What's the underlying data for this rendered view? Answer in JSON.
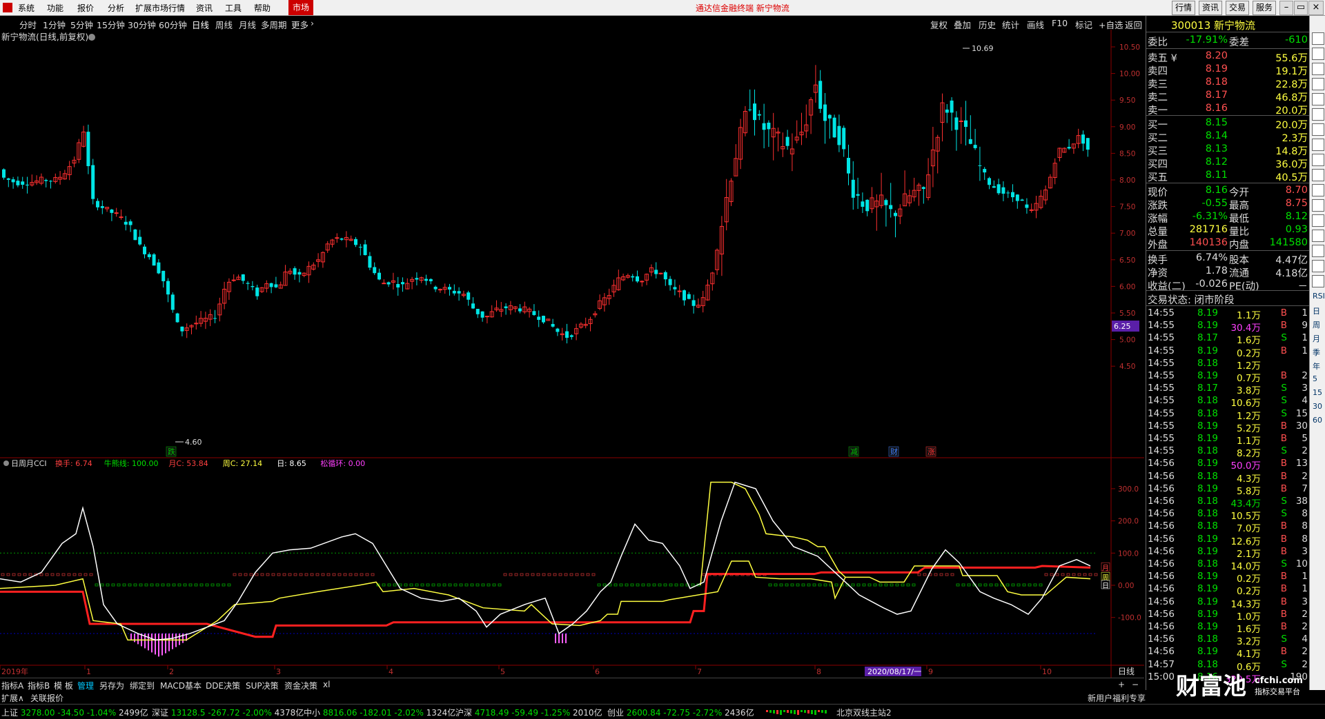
{
  "menubar": {
    "items": [
      "系统",
      "功能",
      "报价",
      "分析",
      "扩展市场行情",
      "资讯",
      "工具",
      "帮助"
    ],
    "market": "市场",
    "app_title": "通达信金融终端  新宁物流",
    "right_buttons": [
      "行情",
      "资讯",
      "交易",
      "服务"
    ]
  },
  "periodbar": {
    "periods": [
      "分时",
      "1分钟",
      "5分钟",
      "15分钟",
      "30分钟",
      "60分钟",
      "日线",
      "周线",
      "月线",
      "多周期",
      "更多"
    ],
    "active": "日线",
    "right": [
      "复权",
      "叠加",
      "历史",
      "统计",
      "画线",
      "F10",
      "标记",
      "+自选",
      "返回"
    ]
  },
  "chart": {
    "title": "新宁物流(日线,前复权)",
    "price_axis": [
      "10.50",
      "10.00",
      "9.50",
      "9.00",
      "8.50",
      "8.00",
      "7.50",
      "7.00",
      "6.50",
      "6.00",
      "5.50",
      "5.00",
      "4.50"
    ],
    "current_price_tag": "6.25",
    "high_label": "10.69",
    "low_label": "4.60",
    "markers": [
      {
        "text": "跌",
        "color": "#00c000"
      },
      {
        "text": "减",
        "color": "#00c000"
      },
      {
        "text": "财",
        "color": "#4080ff"
      },
      {
        "text": "涨",
        "color": "#ff3030"
      }
    ],
    "indicator": {
      "name": "日周月CCI",
      "items": [
        {
          "text": "换手: 6.74",
          "color": "#ff4040"
        },
        {
          "text": "牛熊线: 100.00",
          "color": "#00e000"
        },
        {
          "text": "月C: 53.84",
          "color": "#ff4040"
        },
        {
          "text": "周C: 27.14",
          "color": "#ffff40"
        },
        {
          "text": "日: 8.65",
          "color": "#ffffff"
        },
        {
          "text": "松循环: 0.00",
          "color": "#ff40ff"
        }
      ],
      "axis": [
        "300.0",
        "200.0",
        "100.0",
        "0.00",
        "-100.0"
      ],
      "end_labels": [
        "月",
        "周",
        "日"
      ]
    },
    "date_axis": [
      "2019年",
      "1",
      "2",
      "3",
      "4",
      "5",
      "6",
      "7",
      "8",
      "9",
      "10"
    ],
    "date_highlight": "2020/08/17/一",
    "period_label": "日线"
  },
  "bottom_tabs": [
    "指标A",
    "指标B",
    "模 板",
    "管理",
    "另存为",
    "绑定到",
    "MACD基本",
    "DDE决策",
    "SUP决策",
    "资金决策",
    "xl"
  ],
  "bottom_tabs2": [
    "扩展∧",
    "关联报价"
  ],
  "bottom_right": "新用户福利专享",
  "quote": {
    "code_name": "300013 新宁物流",
    "weibi": {
      "label": "委比",
      "value": "-17.91%",
      "label2": "委差",
      "value2": "-610"
    },
    "asks": [
      {
        "label": "卖五",
        "mark": "¥",
        "price": "8.20",
        "vol": "55.6万"
      },
      {
        "label": "卖四",
        "mark": "",
        "price": "8.19",
        "vol": "19.1万"
      },
      {
        "label": "卖三",
        "mark": "",
        "price": "8.18",
        "vol": "22.8万"
      },
      {
        "label": "卖二",
        "mark": "",
        "price": "8.17",
        "vol": "46.8万"
      },
      {
        "label": "卖一",
        "mark": "",
        "price": "8.16",
        "vol": "20.0万"
      }
    ],
    "bids": [
      {
        "label": "买一",
        "price": "8.15",
        "vol": "20.0万"
      },
      {
        "label": "买二",
        "price": "8.14",
        "vol": "2.3万"
      },
      {
        "label": "买三",
        "price": "8.13",
        "vol": "14.8万"
      },
      {
        "label": "买四",
        "price": "8.12",
        "vol": "36.0万"
      },
      {
        "label": "买五",
        "price": "8.11",
        "vol": "40.5万"
      }
    ],
    "stats": [
      {
        "l1": "现价",
        "v1": "8.16",
        "c1": "#00e000",
        "l2": "今开",
        "v2": "8.70",
        "c2": "#ff5050"
      },
      {
        "l1": "涨跌",
        "v1": "-0.55",
        "c1": "#00e000",
        "l2": "最高",
        "v2": "8.75",
        "c2": "#ff5050"
      },
      {
        "l1": "涨幅",
        "v1": "-6.31%",
        "c1": "#00e000",
        "l2": "最低",
        "v2": "8.12",
        "c2": "#00e000"
      },
      {
        "l1": "总量",
        "v1": "281716",
        "c1": "#ffff40",
        "l2": "量比",
        "v2": "0.93",
        "c2": "#00e000"
      },
      {
        "l1": "外盘",
        "v1": "140136",
        "c1": "#ff5050",
        "l2": "内盘",
        "v2": "141580",
        "c2": "#00e000"
      }
    ],
    "stats2": [
      {
        "l1": "换手",
        "v1": "6.74%",
        "l2": "股本",
        "v2": "4.47亿"
      },
      {
        "l1": "净资",
        "v1": "1.78",
        "l2": "流通",
        "v2": "4.18亿"
      },
      {
        "l1": "收益(二)",
        "v1": "-0.026",
        "l2": "PE(动)",
        "v2": "－"
      }
    ],
    "trade_status": "交易状态: 闭市阶段",
    "ticks": [
      [
        "14:55",
        "8.19",
        "1.1万",
        "B",
        "1"
      ],
      [
        "14:55",
        "8.19",
        "30.4万",
        "B",
        "9"
      ],
      [
        "14:55",
        "8.17",
        "1.6万",
        "S",
        "1"
      ],
      [
        "14:55",
        "8.19",
        "0.2万",
        "B",
        "1"
      ],
      [
        "14:55",
        "8.18",
        "1.2万",
        "",
        ""
      ],
      [
        "14:55",
        "8.19",
        "0.7万",
        "B",
        "2"
      ],
      [
        "14:55",
        "8.17",
        "3.8万",
        "S",
        "3"
      ],
      [
        "14:55",
        "8.18",
        "10.6万",
        "S",
        "4"
      ],
      [
        "14:55",
        "8.18",
        "1.2万",
        "S",
        "15"
      ],
      [
        "14:55",
        "8.19",
        "5.2万",
        "B",
        "30"
      ],
      [
        "14:55",
        "8.19",
        "1.1万",
        "B",
        "5"
      ],
      [
        "14:55",
        "8.18",
        "8.2万",
        "S",
        "2"
      ],
      [
        "14:56",
        "8.19",
        "50.0万",
        "B",
        "13"
      ],
      [
        "14:56",
        "8.18",
        "4.3万",
        "B",
        "2"
      ],
      [
        "14:56",
        "8.19",
        "5.8万",
        "B",
        "7"
      ],
      [
        "14:56",
        "8.18",
        "43.4万",
        "S",
        "38"
      ],
      [
        "14:56",
        "8.18",
        "10.5万",
        "S",
        "8"
      ],
      [
        "14:56",
        "8.18",
        "7.0万",
        "B",
        "8"
      ],
      [
        "14:56",
        "8.19",
        "12.6万",
        "B",
        "8"
      ],
      [
        "14:56",
        "8.19",
        "2.1万",
        "B",
        "3"
      ],
      [
        "14:56",
        "8.18",
        "14.0万",
        "S",
        "10"
      ],
      [
        "14:56",
        "8.19",
        "0.2万",
        "B",
        "1"
      ],
      [
        "14:56",
        "8.19",
        "0.2万",
        "B",
        "1"
      ],
      [
        "14:56",
        "8.19",
        "14.3万",
        "B",
        "3"
      ],
      [
        "14:56",
        "8.19",
        "1.0万",
        "B",
        "2"
      ],
      [
        "14:56",
        "8.19",
        "1.6万",
        "B",
        "2"
      ],
      [
        "14:56",
        "8.18",
        "3.2万",
        "S",
        "4"
      ],
      [
        "14:56",
        "8.19",
        "4.1万",
        "B",
        "2"
      ],
      [
        "14:57",
        "8.18",
        "0.6万",
        "S",
        "2"
      ],
      [
        "15:00",
        "8.16",
        "329.5万",
        "",
        "190"
      ]
    ]
  },
  "side_tools": [
    "RSI",
    "日",
    "周",
    "月",
    "季",
    "年",
    "5",
    "15",
    "30",
    "60"
  ],
  "statusbar": [
    {
      "name": "上证",
      "price": "3278.00",
      "chg": "-34.50",
      "pct": "-1.04%",
      "amt": "2499亿"
    },
    {
      "name": "深证",
      "price": "13128.5",
      "chg": "-267.72",
      "pct": "-2.00%",
      "amt": "4378亿"
    },
    {
      "name": "中小",
      "price": "8816.06",
      "chg": "-182.01",
      "pct": "-2.02%",
      "amt": "1324亿"
    },
    {
      "name": "沪深",
      "price": "4718.49",
      "chg": "-59.49",
      "pct": "-1.25%",
      "amt": "2010亿"
    },
    {
      "name": "创业",
      "price": "2600.84",
      "chg": "-72.75",
      "pct": "-2.72%",
      "amt": "2436亿"
    }
  ],
  "status_server": "北京双线主站2",
  "watermark": {
    "brand": "财富池",
    "site": "cfchi.com",
    "sub": "指标交易平台"
  },
  "colors": {
    "up": "#ff3030",
    "down": "#00e5e5",
    "month_line": "#ff2020",
    "week_line": "#ffff40",
    "day_line": "#ffffff",
    "bull_line": "#00c000"
  }
}
